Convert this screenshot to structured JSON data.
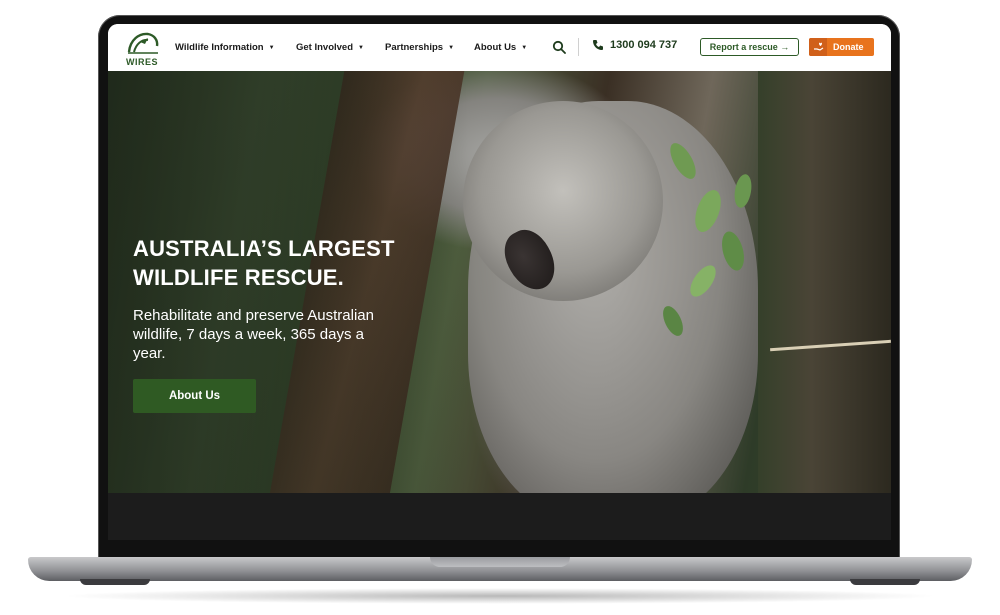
{
  "brand": {
    "name": "WIRES"
  },
  "nav": {
    "items": [
      {
        "label": "Wildlife Information"
      },
      {
        "label": "Get Involved"
      },
      {
        "label": "Partnerships"
      },
      {
        "label": "About Us"
      }
    ],
    "phone": "1300 094 737",
    "report_label": "Report a rescue →",
    "donate_label": "Donate"
  },
  "hero": {
    "title_line1": "AUSTRALIA’S LARGEST",
    "title_line2": "WILDLIFE RESCUE.",
    "subtitle": "Rehabilitate and preserve Australian wildlife, 7 days a week, 365 days a year.",
    "button_label": "About Us"
  },
  "colors": {
    "brand_green": "#2d5a27",
    "donate_orange": "#e8731d",
    "button_green": "#2f5a23"
  },
  "icons": {
    "search": "search-icon",
    "phone": "phone-icon",
    "donate": "donate-hand-icon",
    "caret": "chevron-down-icon"
  }
}
